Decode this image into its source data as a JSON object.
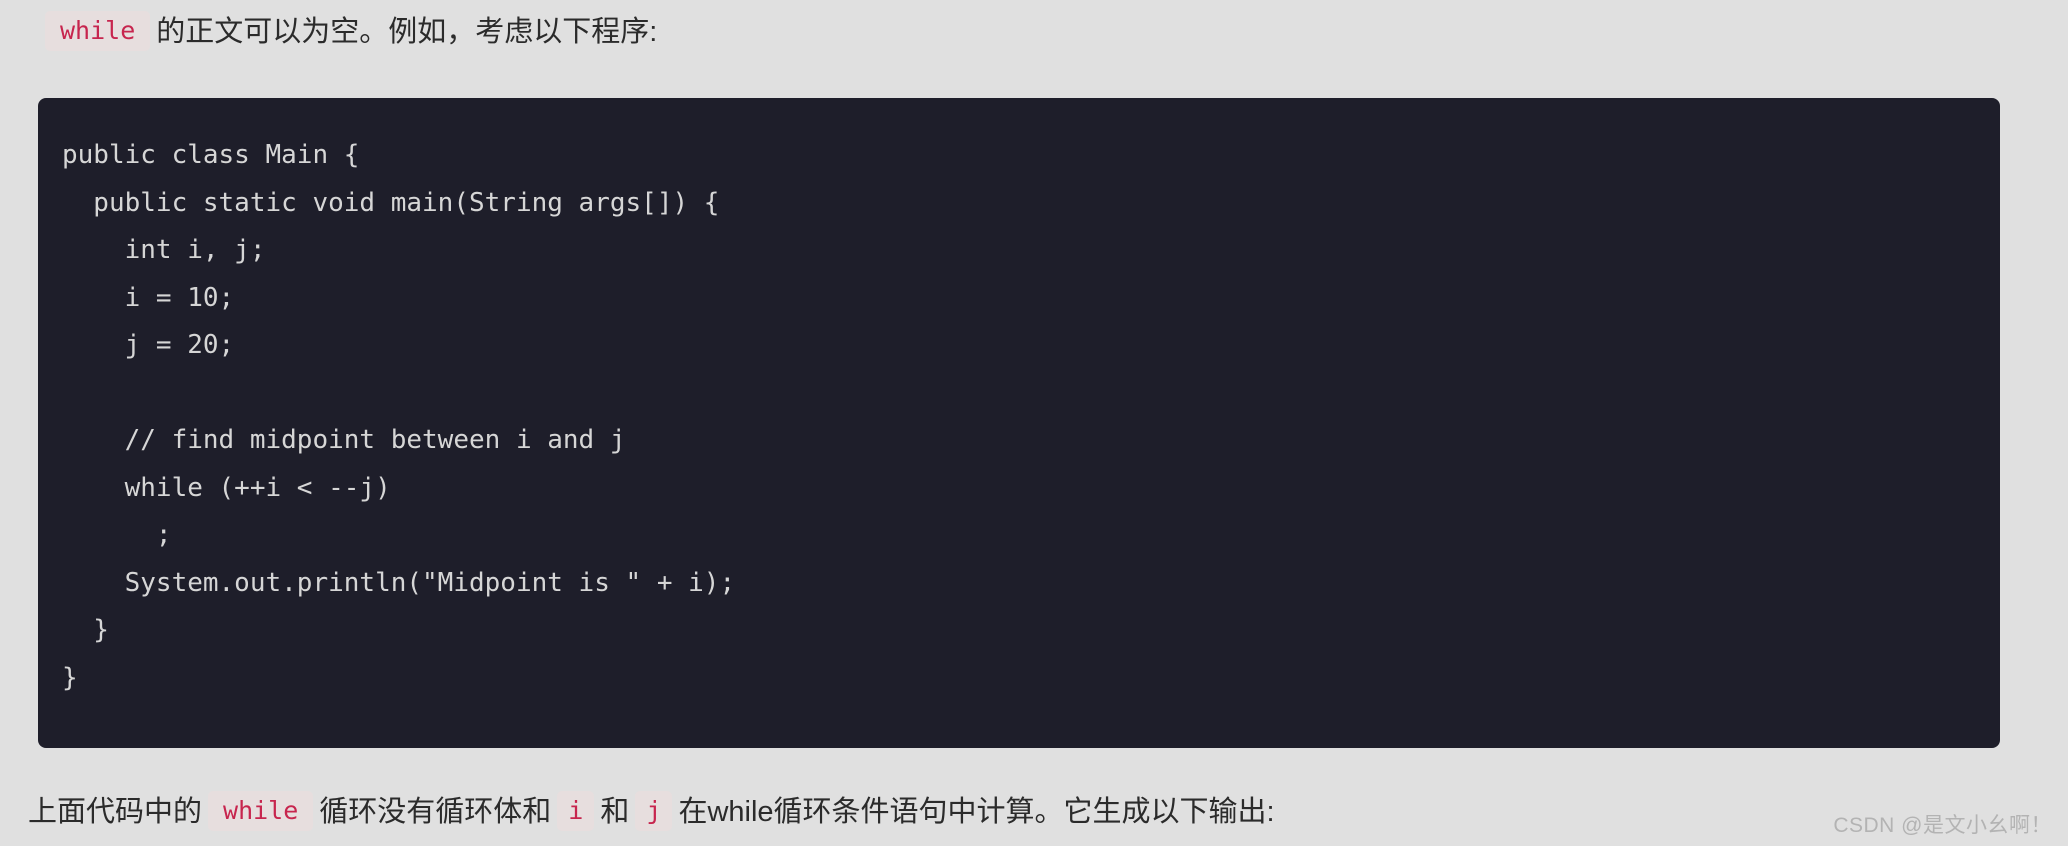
{
  "page": {
    "background_color": "#e0e0e0",
    "text_color": "#2b2b2b"
  },
  "intro_paragraph": {
    "code_chip": "while",
    "text_after": "的正文可以为空。例如，考虑以下程序:"
  },
  "code_block": {
    "language": "java",
    "background_color": "#1e1e2a",
    "text_color": "#d6d6d6",
    "code": "public class Main {\n  public static void main(String args[]) {\n    int i, j;\n    i = 10;\n    j = 20;\n\n    // find midpoint between i and j\n    while (++i < --j)\n      ;\n    System.out.println(\"Midpoint is \" + i);\n  }\n}",
    "lines": [
      "public class Main {",
      "  public static void main(String args[]) {",
      "    int i, j;",
      "    i = 10;",
      "    j = 20;",
      "",
      "    // find midpoint between i and j",
      "    while (++i < --j)",
      "      ;",
      "    System.out.println(\"Midpoint is \" + i);",
      "  }",
      "}"
    ]
  },
  "outro_paragraph": {
    "text_1": "上面代码中的",
    "chip_1": "while",
    "text_2": "循环没有循环体和",
    "chip_2": "i",
    "text_3": "和",
    "chip_3": "j",
    "text_4": "在while循环条件语句中计算。它生成以下输出:"
  },
  "chip_style": {
    "background_color": "#e7dede",
    "text_color": "#c7254e"
  },
  "watermark": {
    "text": "CSDN @是文小幺啊！",
    "color": "#b3b3b3"
  }
}
